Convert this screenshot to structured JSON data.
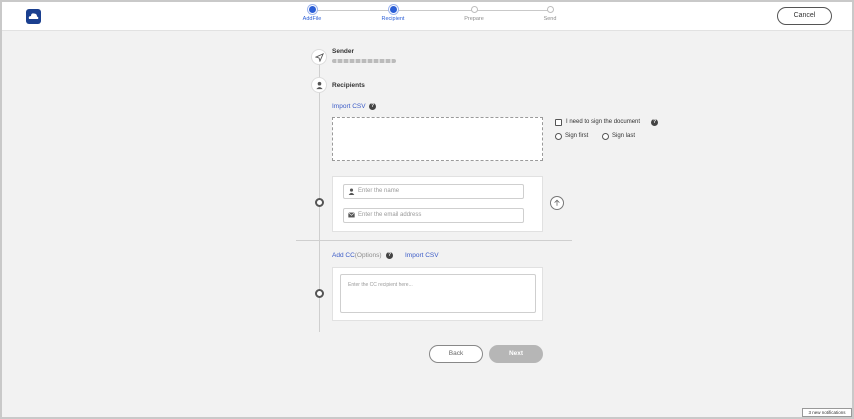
{
  "colors": {
    "accent": "#2c5fd6",
    "link": "#3b5bc7",
    "logo": "#1a3f8f",
    "next_disabled": "#b6b6b6"
  },
  "header": {
    "logo_icon": "cloud-logo-icon",
    "steps": [
      {
        "label": "AddFile",
        "state": "complete"
      },
      {
        "label": "Recipient",
        "state": "active"
      },
      {
        "label": "Prepare",
        "state": "inactive"
      },
      {
        "label": "Send",
        "state": "inactive"
      }
    ],
    "cancel_label": "Cancel"
  },
  "sender": {
    "title": "Sender",
    "icon": "paper-plane-icon"
  },
  "recipients": {
    "title": "Recipients",
    "icon": "person-icon",
    "import_csv": "Import CSV",
    "sign_option": "I need to sign the document",
    "sign_first": "Sign first",
    "sign_last": "Sign last",
    "name_placeholder": "Enter the name",
    "email_placeholder": "Enter the email address",
    "move_up_icon": "arrow-up-icon"
  },
  "cc": {
    "add_label": "Add CC",
    "optional_label": "(Options)",
    "import_csv": "Import CSV",
    "placeholder": "Enter the CC recipient here..."
  },
  "footer": {
    "back_label": "Back",
    "next_label": "Next"
  },
  "notification": "3 new notifications"
}
